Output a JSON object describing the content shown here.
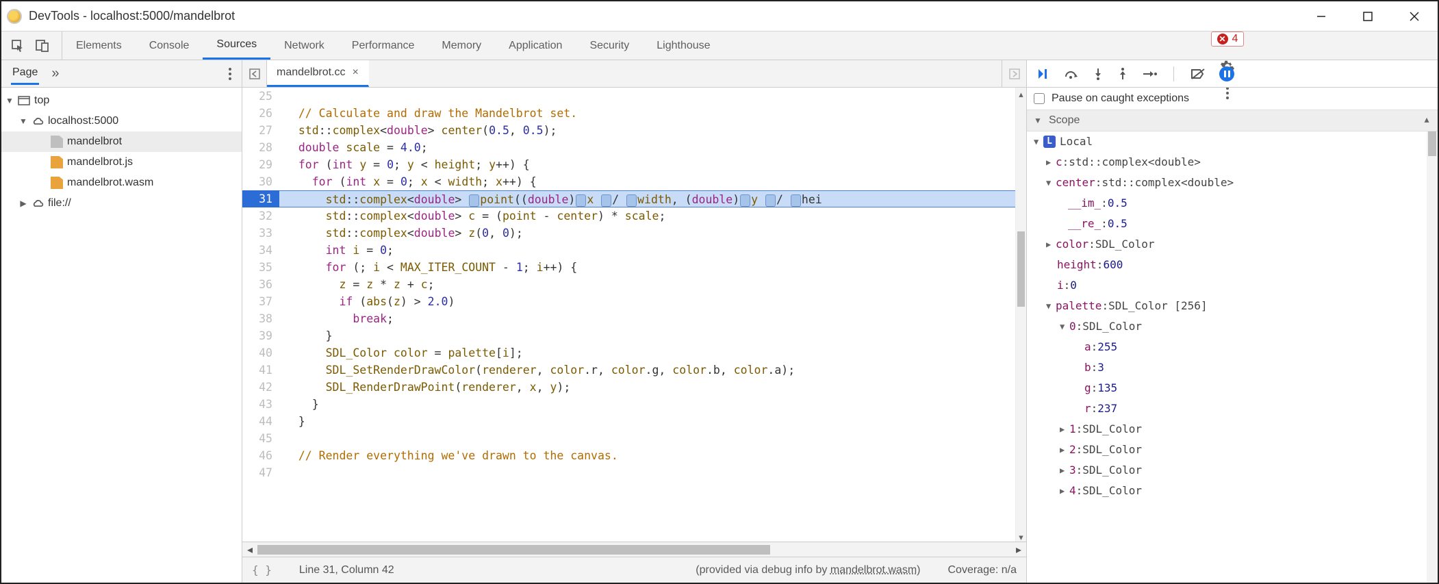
{
  "window": {
    "title": "DevTools - localhost:5000/mandelbrot"
  },
  "mainTabs": {
    "items": [
      "Elements",
      "Console",
      "Sources",
      "Network",
      "Performance",
      "Memory",
      "Application",
      "Security",
      "Lighthouse"
    ],
    "active": "Sources",
    "errorCount": "4"
  },
  "leftNav": {
    "tab": "Page",
    "tree": {
      "top": "top",
      "origin": "localhost:5000",
      "files": [
        "mandelbrot",
        "mandelbrot.js",
        "mandelbrot.wasm"
      ],
      "extra": "file://"
    }
  },
  "editor": {
    "tab": "mandelbrot.cc",
    "firstLine": 25,
    "breakpointLine": 31,
    "lines": [
      "",
      "  // Calculate and draw the Mandelbrot set.",
      "  std::complex<double> center(0.5, 0.5);",
      "  double scale = 4.0;",
      "  for (int y = 0; y < height; y++) {",
      "    for (int x = 0; x < width; x++) {",
      "      std::complex<double> ▯point((double)▯x ▯/ ▯width, (double)▯y ▯/ ▯hei",
      "      std::complex<double> c = (point - center) * scale;",
      "      std::complex<double> z(0, 0);",
      "      int i = 0;",
      "      for (; i < MAX_ITER_COUNT - 1; i++) {",
      "        z = z * z + c;",
      "        if (abs(z) > 2.0)",
      "          break;",
      "      }",
      "      SDL_Color color = palette[i];",
      "      SDL_SetRenderDrawColor(renderer, color.r, color.g, color.b, color.a);",
      "      SDL_RenderDrawPoint(renderer, x, y);",
      "    }",
      "  }",
      "",
      "  // Render everything we've drawn to the canvas.",
      ""
    ],
    "status": {
      "cursor": "Line 31, Column 42",
      "providedPrefix": "(provided via debug info by ",
      "providedLink": "mandelbrot.wasm",
      "providedSuffix": ")",
      "coverage": "Coverage: n/a"
    }
  },
  "debugger": {
    "pauseCheckbox": "Pause on caught exceptions",
    "scopeHeader": "Scope",
    "localLabel": "Local",
    "vars": {
      "c": {
        "name": "c",
        "type": "std::complex<double>"
      },
      "center": {
        "name": "center",
        "type": "std::complex<double>",
        "im": {
          "name": "__im_",
          "val": "0.5"
        },
        "re": {
          "name": "__re_",
          "val": "0.5"
        }
      },
      "color": {
        "name": "color",
        "type": "SDL_Color"
      },
      "height": {
        "name": "height",
        "val": "600"
      },
      "i": {
        "name": "i",
        "val": "0"
      },
      "palette": {
        "name": "palette",
        "type": "SDL_Color [256]",
        "idx0": {
          "name": "0",
          "type": "SDL_Color",
          "a": {
            "name": "a",
            "val": "255"
          },
          "b": {
            "name": "b",
            "val": "3"
          },
          "g": {
            "name": "g",
            "val": "135"
          },
          "r": {
            "name": "r",
            "val": "237"
          }
        },
        "idx1": {
          "name": "1",
          "type": "SDL_Color"
        },
        "idx2": {
          "name": "2",
          "type": "SDL_Color"
        },
        "idx3": {
          "name": "3",
          "type": "SDL_Color"
        },
        "idx4": {
          "name": "4",
          "type": "SDL_Color"
        }
      }
    }
  }
}
